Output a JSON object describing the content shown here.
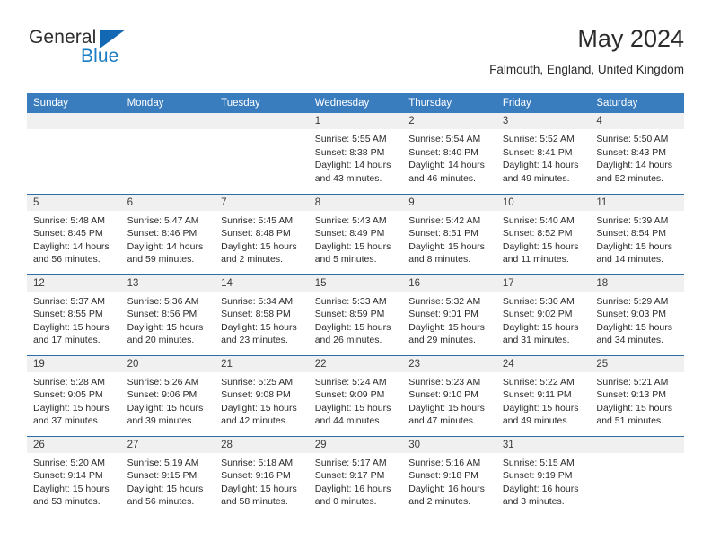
{
  "brand": {
    "word_one": "General",
    "word_two": "Blue",
    "logo_icon": "triangle-flag-icon",
    "colors": {
      "blue": "#1a7cc4",
      "triangle": "#1268b3",
      "dark": "#2e2e2e"
    }
  },
  "header": {
    "title": "May 2024",
    "location": "Falmouth, England, United Kingdom"
  },
  "theme": {
    "header_row_bg": "#3a7dbf",
    "header_row_text": "#ffffff",
    "week_separator": "#2e6da4",
    "daynum_band_bg": "#f0f0f0",
    "body_text": "#2b2b2b"
  },
  "weekday_headers": [
    "Sunday",
    "Monday",
    "Tuesday",
    "Wednesday",
    "Thursday",
    "Friday",
    "Saturday"
  ],
  "labels": {
    "sunrise_prefix": "Sunrise:",
    "sunset_prefix": "Sunset:",
    "daylight_prefix": "Daylight:"
  },
  "calendar": {
    "month": "May",
    "year": "2024",
    "weeks": [
      [
        {
          "empty": true
        },
        {
          "empty": true
        },
        {
          "empty": true
        },
        {
          "day": "1",
          "sunrise": "Sunrise: 5:55 AM",
          "sunset": "Sunset: 8:38 PM",
          "daylight_line1": "Daylight: 14 hours",
          "daylight_line2": "and 43 minutes."
        },
        {
          "day": "2",
          "sunrise": "Sunrise: 5:54 AM",
          "sunset": "Sunset: 8:40 PM",
          "daylight_line1": "Daylight: 14 hours",
          "daylight_line2": "and 46 minutes."
        },
        {
          "day": "3",
          "sunrise": "Sunrise: 5:52 AM",
          "sunset": "Sunset: 8:41 PM",
          "daylight_line1": "Daylight: 14 hours",
          "daylight_line2": "and 49 minutes."
        },
        {
          "day": "4",
          "sunrise": "Sunrise: 5:50 AM",
          "sunset": "Sunset: 8:43 PM",
          "daylight_line1": "Daylight: 14 hours",
          "daylight_line2": "and 52 minutes."
        }
      ],
      [
        {
          "day": "5",
          "sunrise": "Sunrise: 5:48 AM",
          "sunset": "Sunset: 8:45 PM",
          "daylight_line1": "Daylight: 14 hours",
          "daylight_line2": "and 56 minutes."
        },
        {
          "day": "6",
          "sunrise": "Sunrise: 5:47 AM",
          "sunset": "Sunset: 8:46 PM",
          "daylight_line1": "Daylight: 14 hours",
          "daylight_line2": "and 59 minutes."
        },
        {
          "day": "7",
          "sunrise": "Sunrise: 5:45 AM",
          "sunset": "Sunset: 8:48 PM",
          "daylight_line1": "Daylight: 15 hours",
          "daylight_line2": "and 2 minutes."
        },
        {
          "day": "8",
          "sunrise": "Sunrise: 5:43 AM",
          "sunset": "Sunset: 8:49 PM",
          "daylight_line1": "Daylight: 15 hours",
          "daylight_line2": "and 5 minutes."
        },
        {
          "day": "9",
          "sunrise": "Sunrise: 5:42 AM",
          "sunset": "Sunset: 8:51 PM",
          "daylight_line1": "Daylight: 15 hours",
          "daylight_line2": "and 8 minutes."
        },
        {
          "day": "10",
          "sunrise": "Sunrise: 5:40 AM",
          "sunset": "Sunset: 8:52 PM",
          "daylight_line1": "Daylight: 15 hours",
          "daylight_line2": "and 11 minutes."
        },
        {
          "day": "11",
          "sunrise": "Sunrise: 5:39 AM",
          "sunset": "Sunset: 8:54 PM",
          "daylight_line1": "Daylight: 15 hours",
          "daylight_line2": "and 14 minutes."
        }
      ],
      [
        {
          "day": "12",
          "sunrise": "Sunrise: 5:37 AM",
          "sunset": "Sunset: 8:55 PM",
          "daylight_line1": "Daylight: 15 hours",
          "daylight_line2": "and 17 minutes."
        },
        {
          "day": "13",
          "sunrise": "Sunrise: 5:36 AM",
          "sunset": "Sunset: 8:56 PM",
          "daylight_line1": "Daylight: 15 hours",
          "daylight_line2": "and 20 minutes."
        },
        {
          "day": "14",
          "sunrise": "Sunrise: 5:34 AM",
          "sunset": "Sunset: 8:58 PM",
          "daylight_line1": "Daylight: 15 hours",
          "daylight_line2": "and 23 minutes."
        },
        {
          "day": "15",
          "sunrise": "Sunrise: 5:33 AM",
          "sunset": "Sunset: 8:59 PM",
          "daylight_line1": "Daylight: 15 hours",
          "daylight_line2": "and 26 minutes."
        },
        {
          "day": "16",
          "sunrise": "Sunrise: 5:32 AM",
          "sunset": "Sunset: 9:01 PM",
          "daylight_line1": "Daylight: 15 hours",
          "daylight_line2": "and 29 minutes."
        },
        {
          "day": "17",
          "sunrise": "Sunrise: 5:30 AM",
          "sunset": "Sunset: 9:02 PM",
          "daylight_line1": "Daylight: 15 hours",
          "daylight_line2": "and 31 minutes."
        },
        {
          "day": "18",
          "sunrise": "Sunrise: 5:29 AM",
          "sunset": "Sunset: 9:03 PM",
          "daylight_line1": "Daylight: 15 hours",
          "daylight_line2": "and 34 minutes."
        }
      ],
      [
        {
          "day": "19",
          "sunrise": "Sunrise: 5:28 AM",
          "sunset": "Sunset: 9:05 PM",
          "daylight_line1": "Daylight: 15 hours",
          "daylight_line2": "and 37 minutes."
        },
        {
          "day": "20",
          "sunrise": "Sunrise: 5:26 AM",
          "sunset": "Sunset: 9:06 PM",
          "daylight_line1": "Daylight: 15 hours",
          "daylight_line2": "and 39 minutes."
        },
        {
          "day": "21",
          "sunrise": "Sunrise: 5:25 AM",
          "sunset": "Sunset: 9:08 PM",
          "daylight_line1": "Daylight: 15 hours",
          "daylight_line2": "and 42 minutes."
        },
        {
          "day": "22",
          "sunrise": "Sunrise: 5:24 AM",
          "sunset": "Sunset: 9:09 PM",
          "daylight_line1": "Daylight: 15 hours",
          "daylight_line2": "and 44 minutes."
        },
        {
          "day": "23",
          "sunrise": "Sunrise: 5:23 AM",
          "sunset": "Sunset: 9:10 PM",
          "daylight_line1": "Daylight: 15 hours",
          "daylight_line2": "and 47 minutes."
        },
        {
          "day": "24",
          "sunrise": "Sunrise: 5:22 AM",
          "sunset": "Sunset: 9:11 PM",
          "daylight_line1": "Daylight: 15 hours",
          "daylight_line2": "and 49 minutes."
        },
        {
          "day": "25",
          "sunrise": "Sunrise: 5:21 AM",
          "sunset": "Sunset: 9:13 PM",
          "daylight_line1": "Daylight: 15 hours",
          "daylight_line2": "and 51 minutes."
        }
      ],
      [
        {
          "day": "26",
          "sunrise": "Sunrise: 5:20 AM",
          "sunset": "Sunset: 9:14 PM",
          "daylight_line1": "Daylight: 15 hours",
          "daylight_line2": "and 53 minutes."
        },
        {
          "day": "27",
          "sunrise": "Sunrise: 5:19 AM",
          "sunset": "Sunset: 9:15 PM",
          "daylight_line1": "Daylight: 15 hours",
          "daylight_line2": "and 56 minutes."
        },
        {
          "day": "28",
          "sunrise": "Sunrise: 5:18 AM",
          "sunset": "Sunset: 9:16 PM",
          "daylight_line1": "Daylight: 15 hours",
          "daylight_line2": "and 58 minutes."
        },
        {
          "day": "29",
          "sunrise": "Sunrise: 5:17 AM",
          "sunset": "Sunset: 9:17 PM",
          "daylight_line1": "Daylight: 16 hours",
          "daylight_line2": "and 0 minutes."
        },
        {
          "day": "30",
          "sunrise": "Sunrise: 5:16 AM",
          "sunset": "Sunset: 9:18 PM",
          "daylight_line1": "Daylight: 16 hours",
          "daylight_line2": "and 2 minutes."
        },
        {
          "day": "31",
          "sunrise": "Sunrise: 5:15 AM",
          "sunset": "Sunset: 9:19 PM",
          "daylight_line1": "Daylight: 16 hours",
          "daylight_line2": "and 3 minutes."
        },
        {
          "empty": true
        }
      ]
    ]
  }
}
